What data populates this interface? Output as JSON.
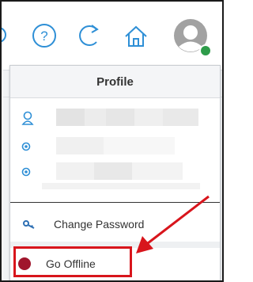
{
  "toolbar": {
    "icons": [
      "nav-icon",
      "help-icon",
      "refresh-icon",
      "home-icon",
      "avatar"
    ],
    "status_color": "#2e9c4a",
    "icon_color": "#2e8fd6"
  },
  "profile_menu": {
    "title": "Profile",
    "info_rows": [
      {
        "icon": "user-icon"
      },
      {
        "icon": "location-icon"
      },
      {
        "icon": "location-icon"
      }
    ],
    "items": [
      {
        "label": "Change Password",
        "icon": "key-icon"
      },
      {
        "label": "Go Offline",
        "icon": "status-dot-icon",
        "color": "#a0162c"
      }
    ]
  },
  "annotation": {
    "color": "#d8151c"
  }
}
